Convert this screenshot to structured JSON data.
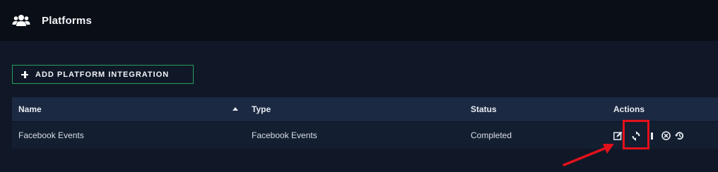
{
  "header": {
    "title": "Platforms",
    "icon": "users-group-icon"
  },
  "toolbar": {
    "add_label": "ADD PLATFORM INTEGRATION",
    "add_icon": "plus-icon"
  },
  "table": {
    "columns": [
      {
        "key": "name",
        "label": "Name"
      },
      {
        "key": "type",
        "label": "Type"
      },
      {
        "key": "status",
        "label": "Status"
      },
      {
        "key": "actions",
        "label": "Actions"
      }
    ],
    "sort": {
      "column": "name",
      "direction": "ascending"
    },
    "rows": [
      {
        "name": "Facebook Events",
        "type": "Facebook Events",
        "status": "Completed",
        "actions": [
          "edit-icon",
          "sync-icon",
          "pause-icon",
          "cancel-icon",
          "history-icon"
        ]
      }
    ]
  },
  "colors": {
    "background": "#101827",
    "header_bg": "#0a0e16",
    "accent_green": "#27a05a",
    "table_header_bg": "#1b2942",
    "row_bg": "#131e30",
    "highlight_red": "#e3111b"
  }
}
